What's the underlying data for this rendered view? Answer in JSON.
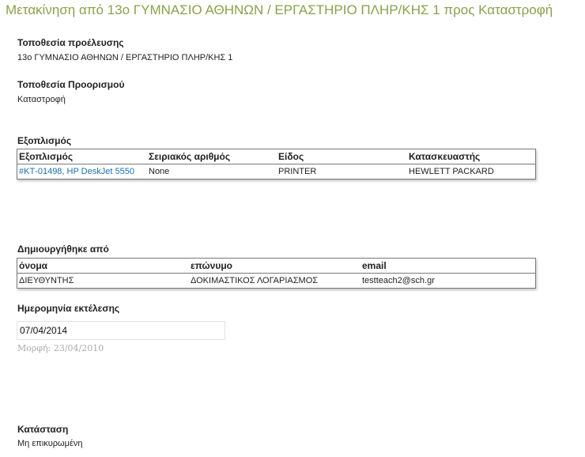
{
  "page": {
    "title": "Μετακίνηση από 13ο ΓΥΜΝΑΣΙΟ ΑΘΗΝΩΝ / ΕΡΓΑΣΤΗΡΙΟ ΠΛΗΡ/ΚΗΣ 1 προς Καταστροφή"
  },
  "origin": {
    "label": "Τοποθεσία προέλευσης",
    "value": "13ο ΓΥΜΝΑΣΙΟ ΑΘΗΝΩΝ / ΕΡΓΑΣΤΗΡΙΟ ΠΛΗΡ/ΚΗΣ 1"
  },
  "destination": {
    "label": "Τοποθεσία Προορισμού",
    "value": "Καταστροφή"
  },
  "equipment": {
    "label": "Εξοπλισμός",
    "columns": [
      "Εξοπλισμός",
      "Σειριακός αριθμός",
      "Είδος",
      "Κατασκευαστής"
    ],
    "rows": [
      {
        "item": "#ΚΤ-01498, HP DeskJet 5550",
        "serial": "None",
        "type": "PRINTER",
        "manufacturer": "HEWLETT PACKARD"
      }
    ]
  },
  "created_by": {
    "label": "Δημιουργήθηκε από",
    "columns": [
      "όνομα",
      "επώνυμο",
      "email"
    ],
    "rows": [
      {
        "first_name": "ΔΙΕΥΘΥΝΤΗΣ",
        "last_name": "ΔΟΚΙΜΑΣΤΙΚΟΣ ΛΟΓΑΡΙΑΣΜΟΣ",
        "email": "testteach2@sch.gr"
      }
    ]
  },
  "execution_date": {
    "label": "Ημερομηνία εκτέλεσης",
    "value": "07/04/2014",
    "hint": "Μορφή: 23/04/2010"
  },
  "status": {
    "label": "Κατάσταση",
    "value": "Μη επικυρωμένη"
  }
}
